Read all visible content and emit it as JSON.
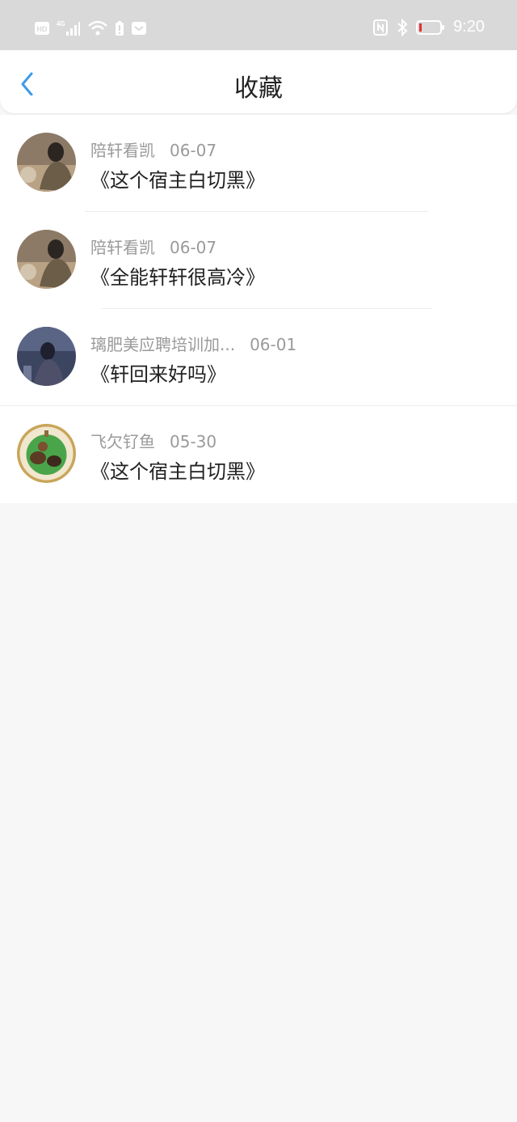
{
  "status_bar": {
    "hd": "HD",
    "network": "4G",
    "time": "9:20",
    "icons": [
      "hd-icon",
      "signal-icon",
      "wifi-icon",
      "battery-saver-icon",
      "message-icon",
      "nfc-icon",
      "bluetooth-icon",
      "battery-icon"
    ]
  },
  "header": {
    "title": "收藏",
    "back_icon": "chevron-left-icon"
  },
  "colors": {
    "accent": "#3d9be9",
    "background": "#f7f7f7",
    "meta_text": "#9a9a9a",
    "title_text": "#222222"
  },
  "favorites": [
    {
      "author": "陪轩看凯",
      "date": "06-07",
      "title": "《这个宿主白切黑》"
    },
    {
      "author": "陪轩看凯",
      "date": "06-07",
      "title": "《全能轩轩很高冷》"
    },
    {
      "author": "璃肥美应聘培训加...",
      "date": "06-01",
      "title": "《轩回来好吗》"
    },
    {
      "author": "飞欠钌鱼",
      "date": "05-30",
      "title": "《这个宿主白切黑》"
    }
  ]
}
